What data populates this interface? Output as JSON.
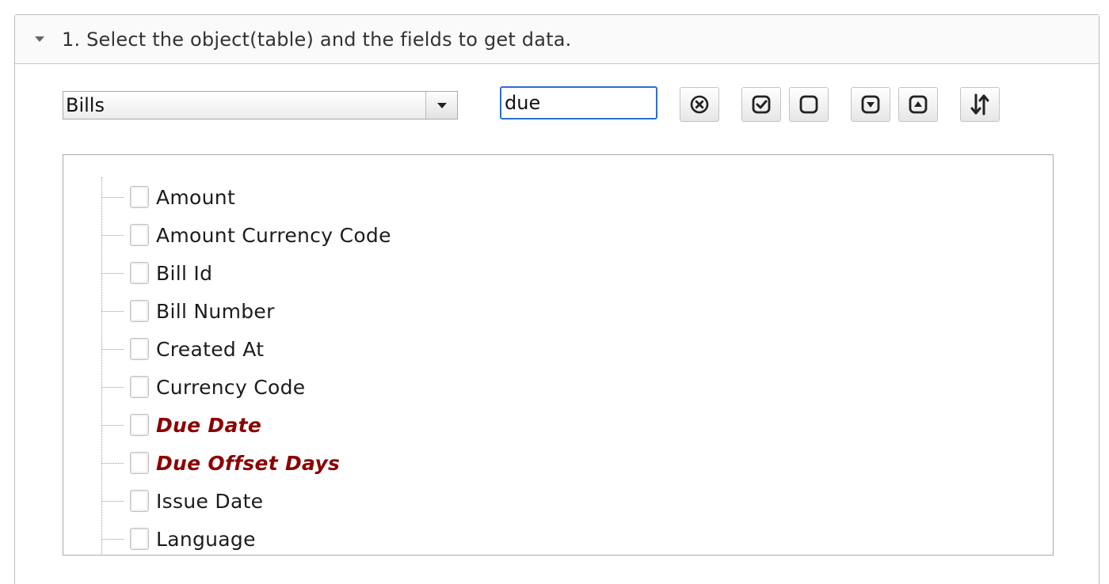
{
  "section": {
    "title": "1. Select the object(table) and the fields to get data.",
    "expanded_icon": "caret-down-icon"
  },
  "toolbar": {
    "object_select": {
      "value": "Bills"
    },
    "filter_input": {
      "value": "due"
    },
    "buttons": [
      {
        "icon": "clear-filter-icon"
      },
      {
        "icon": "check-all-icon"
      },
      {
        "icon": "uncheck-all-icon"
      },
      {
        "icon": "expand-all-icon"
      },
      {
        "icon": "collapse-all-icon"
      },
      {
        "icon": "sort-icon"
      }
    ]
  },
  "fields": [
    {
      "label": "Amount",
      "checked": false,
      "highlighted": false
    },
    {
      "label": "Amount Currency Code",
      "checked": false,
      "highlighted": false
    },
    {
      "label": "Bill Id",
      "checked": false,
      "highlighted": false
    },
    {
      "label": "Bill Number",
      "checked": false,
      "highlighted": false
    },
    {
      "label": "Created At",
      "checked": false,
      "highlighted": false
    },
    {
      "label": "Currency Code",
      "checked": false,
      "highlighted": false
    },
    {
      "label": "Due Date",
      "checked": false,
      "highlighted": true
    },
    {
      "label": "Due Offset Days",
      "checked": false,
      "highlighted": true
    },
    {
      "label": "Issue Date",
      "checked": false,
      "highlighted": false
    },
    {
      "label": "Language",
      "checked": false,
      "highlighted": false
    }
  ],
  "colors": {
    "highlight": "#8b0000",
    "focus_border": "#2a6fcf"
  }
}
